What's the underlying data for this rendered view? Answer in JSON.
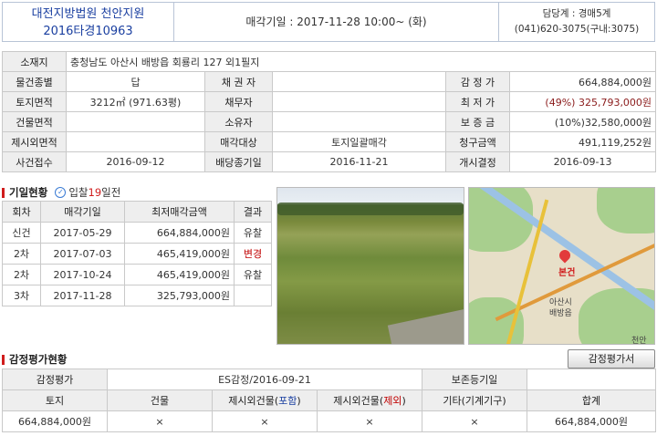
{
  "header": {
    "court_line1": "대전지방법원 천안지원",
    "court_line2": "2016타경10963",
    "sale_date": "매각기일 : 2017-11-28  10:00~ (화)",
    "dept_line1": "담당계 : 경매5계",
    "dept_line2": "(041)620-3075(구내:3075)"
  },
  "info": {
    "location_label": "소재지",
    "location_value": "충청남도 아산시 배방읍 회룡리 127 외1필지",
    "rows": [
      [
        "물건종별",
        "답",
        "채 권 자",
        "",
        "감 정 가",
        "664,884,000원"
      ],
      [
        "토지면적",
        "3212㎡ (971.63평)",
        "채무자",
        "",
        "최 저 가",
        "(49%) 325,793,000원"
      ],
      [
        "건물면적",
        "",
        "소유자",
        "",
        "보 증 금",
        "(10%)32,580,000원"
      ],
      [
        "제시외면적",
        "",
        "매각대상",
        "토지일괄매각",
        "청구금액",
        "491,119,252원"
      ],
      [
        "사건접수",
        "2016-09-12",
        "배당종기일",
        "2016-11-21",
        "개시결정",
        "2016-09-13"
      ]
    ]
  },
  "history": {
    "title": "기일현황",
    "bid_prefix": "입찰",
    "bid_days": "19",
    "bid_suffix": "일전",
    "columns": [
      "회차",
      "매각기일",
      "최저매각금액",
      "결과"
    ],
    "rows": [
      [
        "신건",
        "2017-05-29",
        "664,884,000원",
        "유찰"
      ],
      [
        "2차",
        "2017-07-03",
        "465,419,000원",
        "변경"
      ],
      [
        "2차",
        "2017-10-24",
        "465,419,000원",
        "유찰"
      ],
      [
        "3차",
        "2017-11-28",
        "325,793,000원",
        ""
      ]
    ]
  },
  "map": {
    "pin_label": "본건",
    "labels": [
      "아산시",
      "배방읍",
      "천안"
    ]
  },
  "appraisal": {
    "title": "감정평가현황",
    "button": "감정평가서",
    "row1": [
      "감정평가",
      "ES감정/2016-09-21",
      "보존등기일",
      ""
    ],
    "headers": [
      "토지",
      "건물",
      "제시외건물(",
      "포함",
      ")",
      "제시외건물(",
      "제외",
      ")",
      "기타(기계기구)",
      "합계"
    ],
    "values": [
      "664,884,000원",
      "×",
      "×",
      "×",
      "×",
      "664,884,000원"
    ]
  }
}
